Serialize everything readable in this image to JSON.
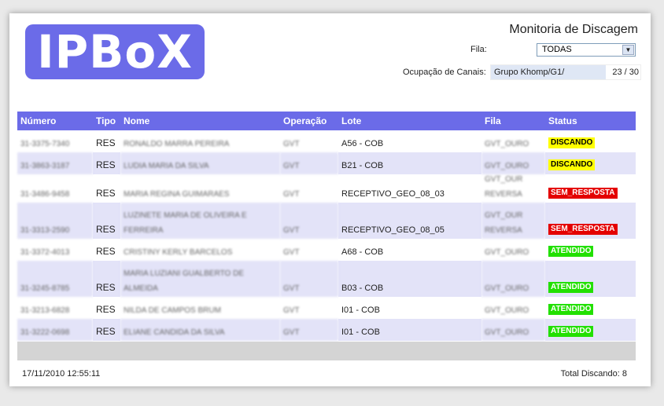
{
  "logo": {
    "text": "IPBoX"
  },
  "header": {
    "title": "Monitoria de Discagem",
    "fila_label": "Fila:",
    "fila_value": "TODAS",
    "ocupacao_label": "Ocupação de Canais:",
    "ocupacao_group": "Grupo Khomp/G1/",
    "ocupacao_count": "23 / 30",
    "ocupacao_fraction": 0.77
  },
  "table": {
    "columns": [
      "Número",
      "Tipo",
      "Nome",
      "Operação",
      "Lote",
      "Fila",
      "Status"
    ],
    "rows": [
      {
        "numero": "31-3375-7340",
        "tipo": "RES",
        "nome": [
          "RONALDO MARRA PEREIRA"
        ],
        "operacao": "GVT",
        "lote": "A56 - COB",
        "fila": [
          "GVT_OURO"
        ],
        "status": "DISCANDO"
      },
      {
        "numero": "31-3863-3187",
        "tipo": "RES",
        "nome": [
          "LUDIA MARIA DA SILVA"
        ],
        "operacao": "GVT",
        "lote": "B21 - COB",
        "fila": [
          "GVT_OURO"
        ],
        "status": "DISCANDO"
      },
      {
        "numero": "31-3486-9458",
        "tipo": "RES",
        "nome": [
          "MARIA REGINA GUIMARAES"
        ],
        "operacao": "GVT",
        "lote": "RECEPTIVO_GEO_08_03",
        "fila": [
          "GVT_OUR",
          "REVERSA"
        ],
        "status": "SEM_RESPOSTA"
      },
      {
        "numero": "31-3313-2590",
        "tipo": "RES",
        "nome": [
          "LUZINETE MARIA DE OLIVEIRA E",
          "FERREIRA"
        ],
        "operacao": "GVT",
        "lote": "RECEPTIVO_GEO_08_05",
        "fila": [
          "GVT_OUR",
          "REVERSA"
        ],
        "status": "SEM_RESPOSTA"
      },
      {
        "numero": "31-3372-4013",
        "tipo": "RES",
        "nome": [
          "CRISTINY KERLY BARCELOS"
        ],
        "operacao": "GVT",
        "lote": "A68 - COB",
        "fila": [
          "GVT_OURO"
        ],
        "status": "ATENDIDO"
      },
      {
        "numero": "31-3245-8785",
        "tipo": "RES",
        "nome": [
          "MARIA LUZIANI GUALBERTO DE",
          "ALMEIDA"
        ],
        "operacao": "GVT",
        "lote": "B03 - COB",
        "fila": [
          "GVT_OURO"
        ],
        "status": "ATENDIDO"
      },
      {
        "numero": "31-3213-6828",
        "tipo": "RES",
        "nome": [
          "NILDA DE CAMPOS BRUM"
        ],
        "operacao": "GVT",
        "lote": "I01 - COB",
        "fila": [
          "GVT_OURO"
        ],
        "status": "ATENDIDO"
      },
      {
        "numero": "31-3222-0698",
        "tipo": "RES",
        "nome": [
          "ELIANE CANDIDA DA SILVA"
        ],
        "operacao": "GVT",
        "lote": "I01 - COB",
        "fila": [
          "GVT_OURO"
        ],
        "status": "ATENDIDO"
      }
    ]
  },
  "footer": {
    "timestamp": "17/11/2010 12:55:11",
    "total": "Total Discando: 8"
  }
}
